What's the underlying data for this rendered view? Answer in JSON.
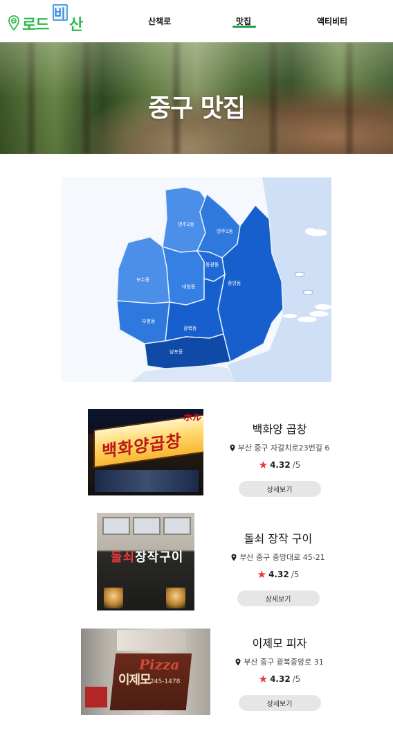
{
  "header": {
    "logo": {
      "text_left": "로드",
      "text_mark": "비",
      "text_right": "산",
      "pin_icon": "map-pin-icon"
    },
    "nav": [
      {
        "label": "산책로",
        "active": false
      },
      {
        "label": "맛집",
        "active": true
      },
      {
        "label": "액티비티",
        "active": false
      }
    ],
    "accent_color": "#1aa24a"
  },
  "hero": {
    "title": "중구 맛집"
  },
  "map": {
    "districts": [
      {
        "name": "영주2동"
      },
      {
        "name": "영주1동"
      },
      {
        "name": "동광동"
      },
      {
        "name": "보수동"
      },
      {
        "name": "대청동"
      },
      {
        "name": "중앙동"
      },
      {
        "name": "부평동"
      },
      {
        "name": "광복동"
      },
      {
        "name": "남포동"
      }
    ],
    "colors": {
      "light": "#4b8fe8",
      "mid": "#2f78de",
      "dark": "#175fcd",
      "darkest": "#0e4aa6",
      "sea": "#cfe0f6"
    }
  },
  "restaurants": [
    {
      "name": "백화양 곱창",
      "address": "부산 중구 자갈치로23번길 6",
      "rating": "4.32",
      "rating_max": "/5",
      "button": "상세보기",
      "photo_sign": "백화양곱창",
      "photo_small": "ホル"
    },
    {
      "name": "돌쇠 장작 구이",
      "address": "부산 중구 중앙대로 45-21",
      "rating": "4.32",
      "rating_max": "/5",
      "button": "상세보기",
      "photo_sign_red": "돌쇠",
      "photo_sign_white": "장작구이"
    },
    {
      "name": "이제모 피자",
      "address": "부산 중구 광복중앙로 31",
      "rating": "4.32",
      "rating_max": "/5",
      "button": "상세보기",
      "photo_sign_en": "Pizza",
      "photo_sign_kr": "이제모",
      "photo_phone": "245-1478"
    }
  ],
  "icons": {
    "location": "location-pin-icon",
    "star": "star-icon"
  }
}
